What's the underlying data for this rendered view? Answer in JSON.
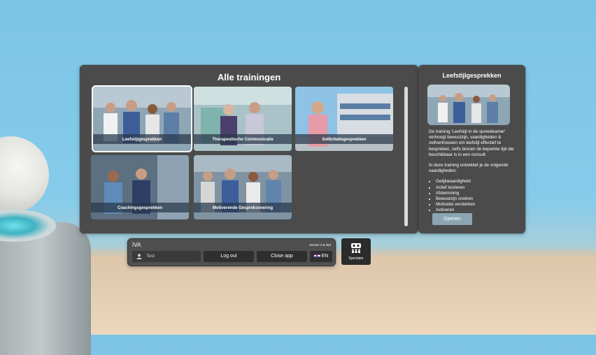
{
  "main_panel": {
    "title": "Alle trainingen",
    "trainings": [
      {
        "label": "Leefstijlgesprekken",
        "selected": true
      },
      {
        "label": "Therapeutische Communicatie",
        "selected": false
      },
      {
        "label": "Sollicitatiegesprekken",
        "selected": false
      },
      {
        "label": "Coachingsgesprekken",
        "selected": false
      },
      {
        "label": "Motiverende Gespreksvoering",
        "selected": false
      }
    ]
  },
  "detail_panel": {
    "title": "Leefstijlgesprekken",
    "description": "De training 'Leefstijl in de spreekkamer' verhoogt bewustzijn, vaardigheden & zelfvertrouwen om leefstijl effectief te bespreken, zelfs binnen de beperkte tijd die beschikbaar is in een consult.",
    "skills_intro": "In deze training ontwikkel je de volgende vaardigheden:",
    "skills": [
      "Gelijkwaardigheid",
      "Actief luisteren",
      "Afstemming",
      "Bewustzijn creëren",
      "Motivatie versterken",
      "Activeren"
    ],
    "open_label": "Openen"
  },
  "footer": {
    "app_name": "IVA",
    "version": "Version 0.9.453",
    "user_name": "Test",
    "logout_label": "Log out",
    "close_label": "Close app",
    "language": "EN"
  },
  "spectator": {
    "label": "Spectator"
  },
  "colors": {
    "panel": "#4b4b4b",
    "button_dark": "#2f2f2f",
    "open_button": "#8ba5b3",
    "sky": "#7cc4e6"
  }
}
